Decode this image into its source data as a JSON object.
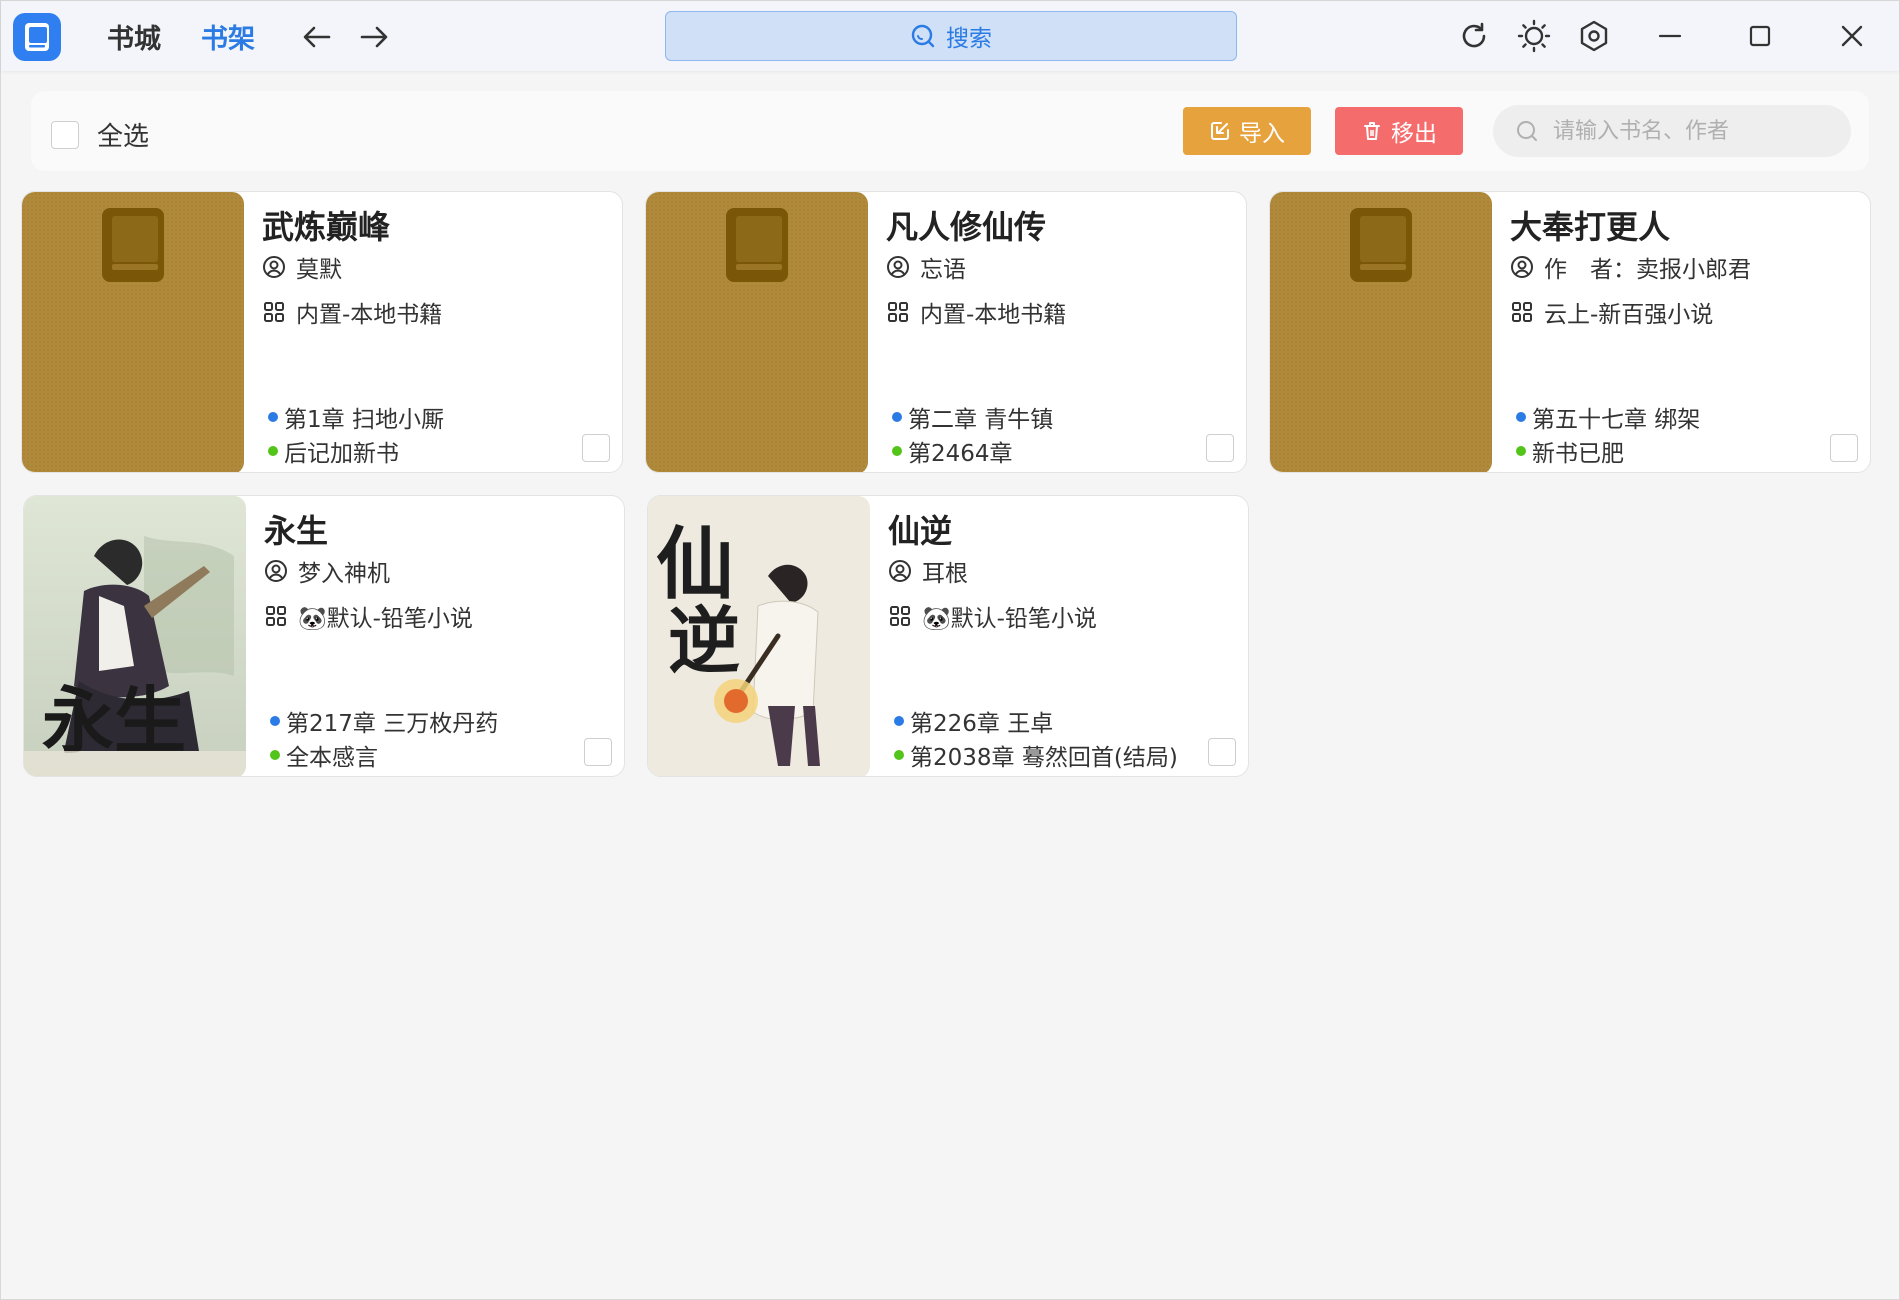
{
  "nav": {
    "store_label": "书城",
    "shelf_label": "书架",
    "search_label": "搜索"
  },
  "toolbar": {
    "select_all_label": "全选",
    "import_label": "导入",
    "remove_label": "移出",
    "filter_placeholder": "请输入书名、作者"
  },
  "colors": {
    "accent": "#2b7be5",
    "import": "#e6a23c",
    "remove": "#f56c6c",
    "current_dot": "#2b7be5",
    "latest_dot": "#52c41a",
    "placeholder_cover": "#b08a3a"
  },
  "books": [
    {
      "title": "武炼巅峰",
      "author": "莫默",
      "source": "内置-本地书籍",
      "current_chapter": "第1章 扫地小厮",
      "latest_chapter": "后记加新书",
      "cover": "placeholder"
    },
    {
      "title": "凡人修仙传",
      "author": "忘语",
      "source": "内置-本地书籍",
      "current_chapter": "第二章 青牛镇",
      "latest_chapter": "第2464章",
      "cover": "placeholder"
    },
    {
      "title": "大奉打更人",
      "author": "作　者：卖报小郎君",
      "source": "云上-新百强小说",
      "current_chapter": "第五十七章 绑架",
      "latest_chapter": "新书已肥",
      "cover": "placeholder"
    },
    {
      "title": "永生",
      "author": "梦入神机",
      "source": "🐼默认-铅笔小说",
      "current_chapter": "第217章 三万枚丹药",
      "latest_chapter": "全本感言",
      "cover": "image"
    },
    {
      "title": "仙逆",
      "author": "耳根",
      "source": "🐼默认-铅笔小说",
      "current_chapter": "第226章 王卓",
      "latest_chapter": "第2038章 蓦然回首(结局)",
      "cover": "image"
    }
  ]
}
